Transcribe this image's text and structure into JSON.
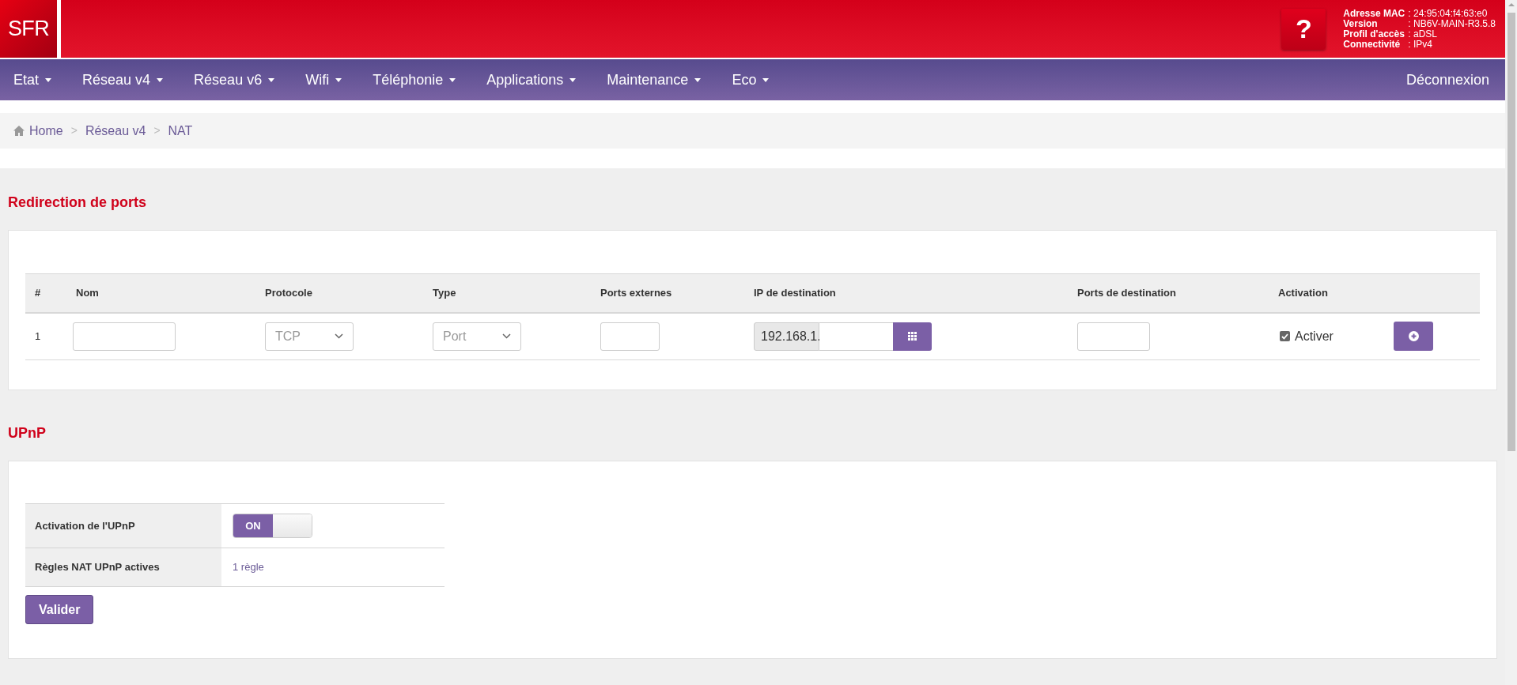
{
  "header": {
    "logo": "SFR",
    "help": "?",
    "info": [
      {
        "label": "Adresse MAC",
        "value": ": 24:95:04:f4:63:e0"
      },
      {
        "label": "Version",
        "value": ": NB6V-MAIN-R3.5.8"
      },
      {
        "label": "Profil d'accès",
        "value": ": aDSL"
      },
      {
        "label": "Connectivité",
        "value": ": IPv4"
      }
    ]
  },
  "nav": {
    "items": [
      {
        "label": "Etat"
      },
      {
        "label": "Réseau v4"
      },
      {
        "label": "Réseau v6"
      },
      {
        "label": "Wifi"
      },
      {
        "label": "Téléphonie"
      },
      {
        "label": "Applications"
      },
      {
        "label": "Maintenance"
      },
      {
        "label": "Eco"
      }
    ],
    "logout": "Déconnexion"
  },
  "breadcrumb": [
    {
      "kind": "home",
      "label": "Home"
    },
    {
      "kind": "separator",
      "label": ">"
    },
    {
      "kind": "link",
      "label": "Réseau v4"
    },
    {
      "kind": "separator",
      "label": ">"
    },
    {
      "kind": "link",
      "label": "NAT"
    }
  ],
  "port_forwarding": {
    "title": "Redirection de ports",
    "columns": [
      "#",
      "Nom",
      "Protocole",
      "Type",
      "Ports externes",
      "IP de destination",
      "Ports de destination",
      "Activation"
    ],
    "rows": [
      {
        "index": "1",
        "protocol": "TCP",
        "type": "Port",
        "ip_prefix": "192.168.1.",
        "activate": {
          "label": "Activer",
          "checked": true
        }
      }
    ]
  },
  "upnp": {
    "title": "UPnP",
    "rows": [
      {
        "kind": "toggle",
        "label": "Activation de l'UPnP",
        "toggle": {
          "label": "ON",
          "on": true
        }
      },
      {
        "kind": "link",
        "label": "Règles NAT UPnP actives",
        "value": "1 règle"
      }
    ],
    "submit": "Valider"
  }
}
